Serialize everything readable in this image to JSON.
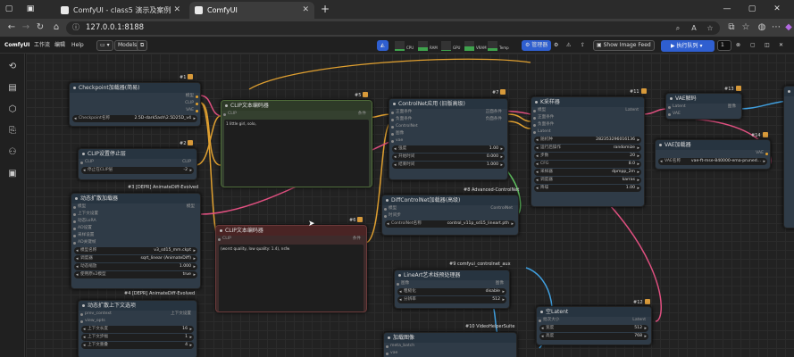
{
  "browser": {
    "tabs": [
      {
        "label": "ComfyUI - class5 演示及案例"
      },
      {
        "label": "ComfyUI"
      }
    ],
    "url": "127.0.0.1:8188"
  },
  "menu": {
    "logo": "ComfyUI",
    "items": [
      "工作流",
      "编辑",
      "Help"
    ],
    "models": "Models",
    "gauges": [
      {
        "label": "CPU",
        "value": 0.15
      },
      {
        "label": "RAM",
        "value": 0.35
      },
      {
        "label": "GPU",
        "value": 0.1
      },
      {
        "label": "VRAM",
        "value": 0.45
      },
      {
        "label": "Temp",
        "value": 0.3
      }
    ],
    "manager": "管理器",
    "show_feed": "Show Image Feed",
    "queue": "执行队列",
    "batch": "1"
  },
  "nodes": {
    "checkpoint": {
      "title": "Checkpoint加载器(简易)",
      "id": "#1",
      "outs": [
        "模型",
        "CLIP",
        "VAE"
      ],
      "widget_label": "Checkpoint名称",
      "widget_value": "2.5D-dark5ash\\2.5D25D_v4"
    },
    "clipskip": {
      "title": "CLIP设置停止层",
      "id": "#2",
      "in": "CLIP",
      "out": "CLIP",
      "widget_label": "停止在CLIP层",
      "widget_value": "-2",
      "footer": "#3 [DEPR] AnimateDiff-Evolved"
    },
    "animdiff": {
      "title": "动态扩散加载器",
      "out": "模型",
      "ins": [
        "模型",
        "上下文设置",
        "动态LoRA",
        "AD设置",
        "采样设置",
        "AD关键帧"
      ],
      "widgets": [
        {
          "l": "模型名称",
          "v": "v3_sd15_mm.ckpt"
        },
        {
          "l": "调度器",
          "v": "sqrt_linear (AnimateDiff)"
        },
        {
          "l": "动态缩放",
          "v": "1.000"
        },
        {
          "l": "使用原v2模型",
          "v": "true"
        }
      ],
      "footer": "#4 [DEPR] AnimateDiff-Evolved"
    },
    "context": {
      "title": "动态扩散上下文选项",
      "out": "上下文设置",
      "ins": [
        "prev_context",
        "view_opts"
      ],
      "widgets": [
        {
          "l": "上下文长度",
          "v": "16"
        },
        {
          "l": "上下文步幅",
          "v": "1"
        },
        {
          "l": "上下文重叠",
          "v": "4"
        }
      ]
    },
    "clip_pos": {
      "title": "CLIP文本编码器",
      "id": "#5",
      "in": "CLIP",
      "out": "条件",
      "text": "1 little girl, solo,"
    },
    "clip_neg": {
      "title": "CLIP文本编码器",
      "id": "#6",
      "in": "CLIP",
      "out": "条件",
      "text": "(worst quality, low quality: 1.4), nsfw"
    },
    "controlnet": {
      "title": "ControlNet应用 (旧版高级)",
      "id": "#7",
      "ins": [
        "正面条件",
        "负面条件",
        "ControlNet",
        "图像",
        "vae"
      ],
      "outs": [
        "正面条件",
        "负面条件"
      ],
      "widgets": [
        {
          "l": "强度",
          "v": "1.00"
        },
        {
          "l": "开始时间",
          "v": "0.000"
        },
        {
          "l": "结束时间",
          "v": "1.000"
        }
      ],
      "footer": "#8 Advanced-ControlNet"
    },
    "diffcn": {
      "title": "DiffControlNet加载器(高级)",
      "ins": [
        "模型",
        "时间步"
      ],
      "out": "ControlNet",
      "widget_label": "ControlNet名称",
      "widget_value": "control_v11p_sd15_lineart.pth",
      "footer": "#9 comfyui_controlnet_aux"
    },
    "lineart": {
      "title": "LineArt艺术线预处理器",
      "in": "图像",
      "out": "图像",
      "widgets": [
        {
          "l": "粗糙化",
          "v": "disable"
        },
        {
          "l": "分辨率",
          "v": "512"
        }
      ],
      "footer": "#10 VideoHelperSuite"
    },
    "loadimg": {
      "title": "加载图像",
      "ins": [
        "meta_batch",
        "vae"
      ]
    },
    "ksampler": {
      "title": "K采样器",
      "id": "#11",
      "ins": [
        "模型",
        "正面条件",
        "负面条件",
        "Latent"
      ],
      "out": "Latent",
      "widgets": [
        {
          "l": "随机种",
          "v": "282353296016136"
        },
        {
          "l": "运行后操作",
          "v": "randomize"
        },
        {
          "l": "步数",
          "v": "20"
        },
        {
          "l": "CFG",
          "v": "8.0"
        },
        {
          "l": "采样器",
          "v": "dpmpp_2m"
        },
        {
          "l": "调度器",
          "v": "karras"
        },
        {
          "l": "降噪",
          "v": "1.00"
        }
      ]
    },
    "vaedecode": {
      "title": "VAE解码",
      "id": "#13",
      "ins": [
        "Latent",
        "VAE"
      ],
      "out": "图像"
    },
    "vaeloader": {
      "title": "VAE加载器",
      "id": "#14",
      "out": "VAE",
      "widget_label": "VAE名称",
      "widget_value": "vae-ft-mse-840000-ema-pruned..."
    },
    "latent": {
      "title": "空Latent",
      "id": "#12",
      "in": "批次大小",
      "out": "Latent",
      "widgets": [
        {
          "l": "宽度",
          "v": "512"
        },
        {
          "l": "高度",
          "v": "768"
        }
      ]
    }
  },
  "colors": {
    "accent": "#2f5fd0",
    "wire_orange": "#e0a030",
    "wire_pink": "#e05080",
    "wire_blue": "#40a0e0",
    "wire_green": "#60c060"
  }
}
